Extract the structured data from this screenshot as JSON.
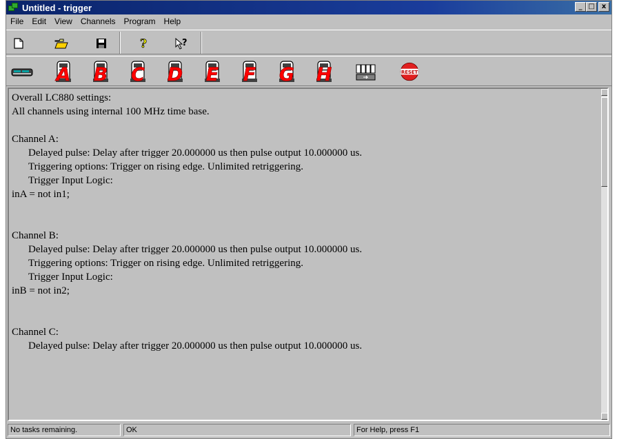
{
  "window": {
    "title": "Untitled - trigger",
    "controls": {
      "minimize": "_",
      "maximize": "□",
      "close": "x"
    }
  },
  "menubar": {
    "items": [
      {
        "label": "File",
        "mnemonic": "F"
      },
      {
        "label": "Edit",
        "mnemonic": "E"
      },
      {
        "label": "View",
        "mnemonic": "V"
      },
      {
        "label": "Channels",
        "mnemonic": "C"
      },
      {
        "label": "Program",
        "mnemonic": "P"
      },
      {
        "label": "Help",
        "mnemonic": "H"
      }
    ]
  },
  "toolbar": {
    "buttons": [
      "new-file-icon",
      "open-folder-icon",
      "save-disk-icon",
      "help-question-icon",
      "context-help-icon"
    ]
  },
  "channel_toolbar": {
    "channels": [
      "A",
      "B",
      "C",
      "D",
      "E",
      "F",
      "G",
      "H"
    ],
    "overlay_color": "#ff0000",
    "reset_label": "RESET"
  },
  "content": {
    "lines": [
      {
        "text": "Overall LC880 settings:",
        "indent": false
      },
      {
        "text": "All channels using internal 100 MHz time base.",
        "indent": false
      },
      {
        "text": "",
        "indent": false
      },
      {
        "text": "Channel A:",
        "indent": false
      },
      {
        "text": "Delayed pulse: Delay after trigger 20.000000 us then pulse output 10.000000 us.",
        "indent": true
      },
      {
        "text": "Triggering options: Trigger on rising edge. Unlimited retriggering.",
        "indent": true
      },
      {
        "text": "Trigger Input Logic:",
        "indent": true
      },
      {
        "text": "inA = not in1;",
        "indent": false
      },
      {
        "text": "",
        "indent": false
      },
      {
        "text": "",
        "indent": false
      },
      {
        "text": "Channel B:",
        "indent": false
      },
      {
        "text": "Delayed pulse: Delay after trigger 20.000000 us then pulse output 10.000000 us.",
        "indent": true
      },
      {
        "text": "Triggering options: Trigger on rising edge. Unlimited retriggering.",
        "indent": true
      },
      {
        "text": "Trigger Input Logic:",
        "indent": true
      },
      {
        "text": "inB = not in2;",
        "indent": false
      },
      {
        "text": "",
        "indent": false
      },
      {
        "text": "",
        "indent": false
      },
      {
        "text": "Channel C:",
        "indent": false
      },
      {
        "text": "Delayed pulse: Delay after trigger 20.000000 us then pulse output 10.000000 us.",
        "indent": true
      }
    ]
  },
  "statusbar": {
    "tasks": "No tasks remaining.",
    "state": "OK",
    "help": "For Help, press F1"
  }
}
